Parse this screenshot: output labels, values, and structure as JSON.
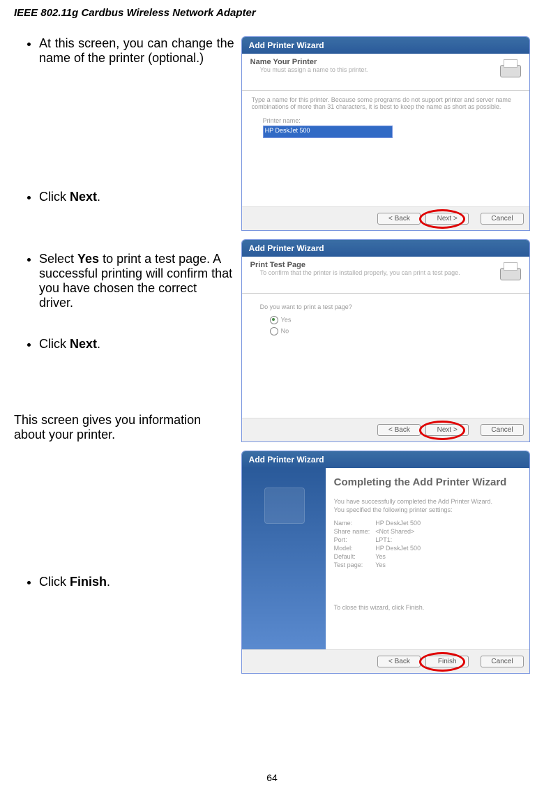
{
  "header": "IEEE 802.11g Cardbus Wireless Network Adapter",
  "page_number": "64",
  "instructions": {
    "step1a": "At this screen, you can change the name of the printer (optional.)",
    "step1b_prefix": "Click ",
    "step1b_bold": "Next",
    "step1b_suffix": ".",
    "step2a_prefix": "Select ",
    "step2a_bold": "Yes",
    "step2a_suffix": " to print a test page.  A successful printing will confirm that you have chosen the correct driver.",
    "step2b_prefix": "Click ",
    "step2b_bold": "Next",
    "step2b_suffix": ".",
    "step3_text": "This screen gives you information about your printer.",
    "step3b_prefix": "Click ",
    "step3b_bold": "Finish",
    "step3b_suffix": "."
  },
  "dialog1": {
    "title": "Add Printer Wizard",
    "head_title": "Name Your Printer",
    "head_sub": "You must assign a name to this printer.",
    "body_text": "Type a name for this printer. Because some programs do not support printer and server name combinations of more than 31 characters, it is best to keep the name as short as possible.",
    "label": "Printer name:",
    "input_value": "HP DeskJet 500",
    "back": "< Back",
    "next": "Next >",
    "cancel": "Cancel"
  },
  "dialog2": {
    "title": "Add Printer Wizard",
    "head_title": "Print Test Page",
    "head_sub": "To confirm that the printer is installed properly, you can print a test page.",
    "question": "Do you want to print a test page?",
    "opt_yes": "Yes",
    "opt_no": "No",
    "back": "< Back",
    "next": "Next >",
    "cancel": "Cancel"
  },
  "dialog3": {
    "title": "Add Printer Wizard",
    "big_title": "Completing the Add Printer Wizard",
    "line1": "You have successfully completed the Add Printer Wizard.",
    "line2": "You specified the following printer settings:",
    "kv": {
      "name_k": "Name:",
      "name_v": "HP DeskJet 500",
      "share_k": "Share name:",
      "share_v": "<Not Shared>",
      "port_k": "Port:",
      "port_v": "LPT1:",
      "model_k": "Model:",
      "model_v": "HP DeskJet 500",
      "default_k": "Default:",
      "default_v": "Yes",
      "test_k": "Test page:",
      "test_v": "Yes"
    },
    "close_text": "To close this wizard, click Finish.",
    "back": "< Back",
    "finish": "Finish",
    "cancel": "Cancel"
  }
}
